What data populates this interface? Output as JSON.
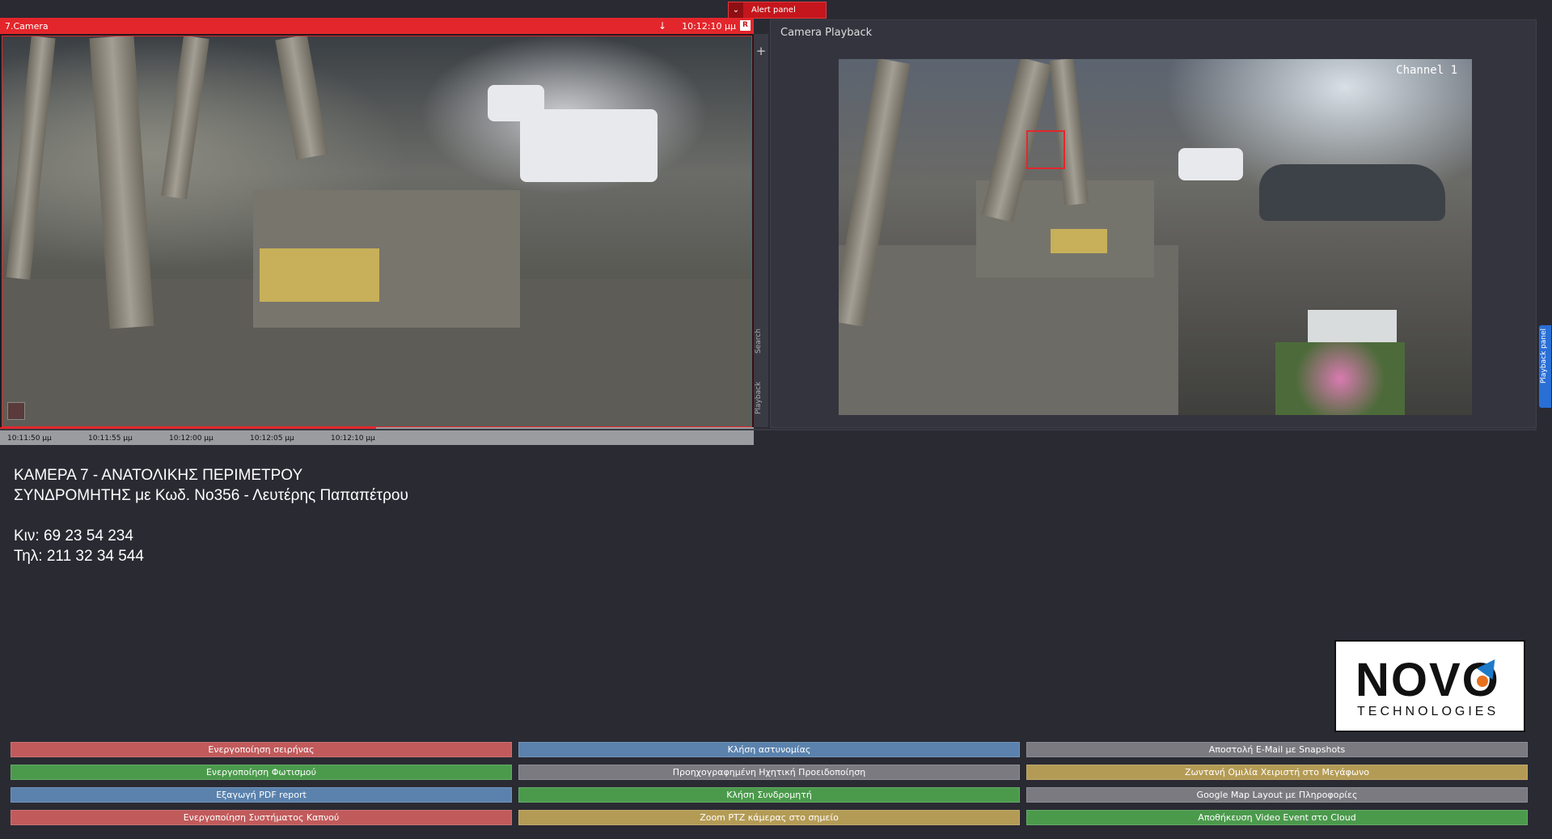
{
  "alert_panel": {
    "label": "Alert panel",
    "color": "#c4161c"
  },
  "camera": {
    "title": "7.Camera",
    "time": "10:12:10 μμ",
    "rec_badge": "R",
    "timeline": [
      "10:11:50 μμ",
      "10:11:55 μμ",
      "10:12:00 μμ",
      "10:12:05 μμ",
      "10:12:10 μμ"
    ],
    "side_tabs": {
      "search": "Search",
      "playback": "Playback"
    }
  },
  "playback": {
    "title": "Camera Playback",
    "watermark": "Channel 1",
    "side_tab": "Playback panel"
  },
  "info": {
    "line1": "ΚΑΜΕΡΑ 7 - ΑΝΑΤΟΛΙΚΗΣ ΠΕΡΙΜΕΤΡΟΥ",
    "line2": "ΣΥΝΔΡΟΜΗΤΗΣ με Κωδ. Νο356 - Λευτέρης Παπαπέτρου",
    "line3": "Κιν: 69 23 54 234",
    "line4": "Τηλ: 211 32 34 544"
  },
  "logo": {
    "word": "NOVO",
    "sub": "TECHNOLOGIES"
  },
  "buttons": [
    {
      "label": "Ενεργοποίηση σειρήνας",
      "color": "red"
    },
    {
      "label": "Κλήση αστυνομίας",
      "color": "blue"
    },
    {
      "label": "Αποστολή E-Mail με Snapshots",
      "color": "gray"
    },
    {
      "label": "Ενεργοποίηση Φωτισμού",
      "color": "green"
    },
    {
      "label": "Προηχογραφημένη Ηχητική Προειδοποίηση",
      "color": "gray"
    },
    {
      "label": "Ζωντανή Ομιλία Χειριστή στο Μεγάφωνο",
      "color": "gold"
    },
    {
      "label": "Εξαγωγή PDF report",
      "color": "blue"
    },
    {
      "label": "Κλήση Συνδρομητή",
      "color": "green"
    },
    {
      "label": "Google Map Layout με Πληροφορίες",
      "color": "gray"
    },
    {
      "label": "Ενεργοποίηση Συστήματος Καπνού",
      "color": "red"
    },
    {
      "label": "Zoom PTZ κάμερας στο σημείο",
      "color": "gold"
    },
    {
      "label": "Αποθήκευση Video Event στο Cloud",
      "color": "green"
    }
  ]
}
